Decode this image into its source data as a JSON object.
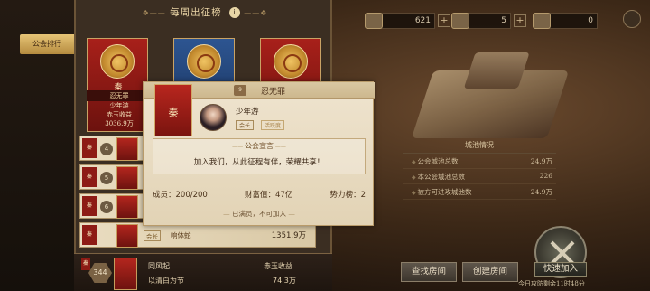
{
  "panel": {
    "title": "每周出征榜",
    "title_info_icon": "i",
    "sidebar_tab": "公会排行"
  },
  "top_winner": {
    "guild": "忍无罪",
    "flag": "秦",
    "leader": "少年游",
    "label": "赤玉收益",
    "value": "3036.9万"
  },
  "top_cards": [
    {
      "flag": "秦",
      "color": "#a8201a"
    },
    {
      "flag": "秦",
      "color": "#2d5591"
    },
    {
      "flag": "秦",
      "color": "#a8201a"
    }
  ],
  "rank_rows": [
    {
      "tag": "秦",
      "rank": "4",
      "badge": "",
      "leader": "",
      "value": ""
    },
    {
      "tag": "秦",
      "rank": "5",
      "badge": "",
      "leader": "",
      "value": ""
    },
    {
      "tag": "秦",
      "rank": "6",
      "badge": "",
      "leader": "",
      "value": ""
    },
    {
      "tag": "秦",
      "rank": "",
      "badge": "会长",
      "leader": "响体蛇",
      "value": "1351.9万"
    }
  ],
  "self_bar": {
    "rank": "344",
    "tag": "秦",
    "name": "同风起",
    "slogan": "以清白为节",
    "col_header": "赤玉收益",
    "col_value": "74.3万"
  },
  "popup": {
    "guild_name": "忍无罪",
    "flag": "秦",
    "level": "9",
    "leader_name": "少年游",
    "role": "会长",
    "role2": "活跃度",
    "announcement_header": "公会宣言",
    "announcement": "加入我们，从此征程有伴，荣耀共享！",
    "members_label": "成员：",
    "members_value": "200/200",
    "wealth_label": "财富值：",
    "wealth_value": "47亿",
    "power_label": "势力榜：",
    "power_value": "2",
    "full_notice": "已满员，不可加入"
  },
  "resources": [
    {
      "value": "621"
    },
    {
      "value": "5"
    },
    {
      "value": "0"
    }
  ],
  "city_info": {
    "header": "城池情况",
    "rows": [
      {
        "label": "公会城池总数",
        "value": "24.9万"
      },
      {
        "label": "本公会城池总数",
        "value": "226"
      },
      {
        "label": "被方可进攻城池数",
        "value": "24.9万"
      }
    ]
  },
  "buttons": {
    "search_room": "查找房间",
    "create_room": "创建房间",
    "quick_join": "快速加入",
    "defend_notice": "今日攻防剩余11时48分"
  }
}
